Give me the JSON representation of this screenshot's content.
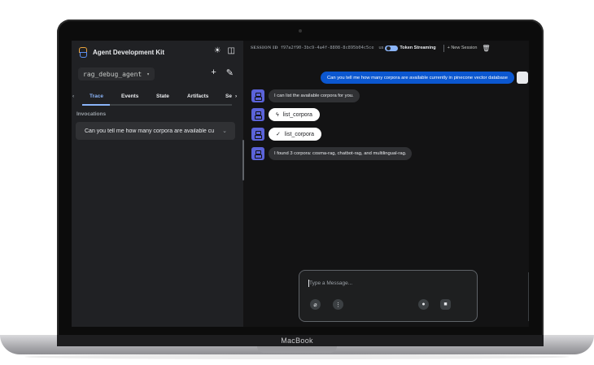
{
  "device": {
    "brand": "MacBook"
  },
  "sidebar": {
    "title": "Agent Development Kit",
    "agent_name": "rag_debug_agent",
    "tabs": [
      {
        "label": "Trace",
        "active": true
      },
      {
        "label": "Events",
        "active": false
      },
      {
        "label": "State",
        "active": false
      },
      {
        "label": "Artifacts",
        "active": false
      },
      {
        "label": "Se",
        "active": false
      }
    ],
    "invocations_label": "Invocations",
    "invocation_item": "Can you tell me how many corpora are available cu"
  },
  "topbar": {
    "session_label": "SESSION ID",
    "session_id": "f97a2f90-3bc9-4a4f-8808-8c895b04c5ce",
    "user_label": "us",
    "token_streaming": "Token Streaming",
    "new_session": "+ New Session"
  },
  "messages": {
    "user": "Can you tell me how many corpora are available currently in pinecone vector database",
    "bot_1": "I can list the available corpora for you.",
    "tool_call": "list_corpora",
    "tool_result": "list_corpora",
    "bot_2": "I found 3 corpora: cosma-rag, chatbot-rag, and multilingual-rag."
  },
  "composer": {
    "placeholder": "Type a Message..."
  },
  "colors": {
    "accent": "#8ab4f8",
    "user_bubble": "#0b57d0",
    "bot_avatar": "#5b63d9",
    "background": "#131314"
  },
  "icons": {
    "logo": "adk-logo-icon",
    "theme": "sun-icon",
    "panel": "sidebar-toggle-icon",
    "add": "plus-icon",
    "edit": "pencil-icon",
    "delete": "trash-icon",
    "attach": "paperclip-icon",
    "more": "more-vert-icon",
    "mic": "mic-icon",
    "video": "video-icon"
  }
}
